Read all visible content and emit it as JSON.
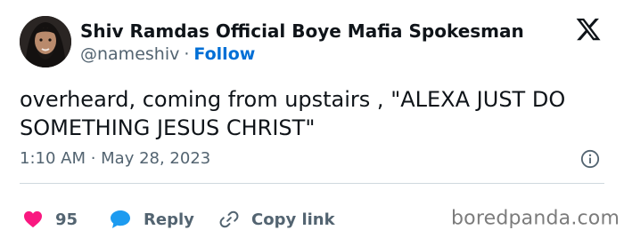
{
  "author": {
    "name": "Shiv Ramdas Official Boye Mafia Spokesman",
    "handle": "@nameshiv",
    "separator": "·",
    "follow_label": "Follow"
  },
  "tweet": {
    "text": "overheard, coming from upstairs , \"ALEXA JUST DO SOMETHING JESUS CHRIST\"",
    "timestamp": "1:10 AM · May 28, 2023"
  },
  "actions": {
    "likes_count": "95",
    "reply_label": "Reply",
    "copy_link_label": "Copy link"
  },
  "watermark": "boredpanda.com",
  "colors": {
    "accent": "#006fd6",
    "like": "#f91880",
    "reply": "#1d9bf0",
    "muted": "#536471"
  },
  "icons": [
    "x-logo-icon",
    "info-icon",
    "heart-icon",
    "reply-bubble-icon",
    "link-icon"
  ]
}
